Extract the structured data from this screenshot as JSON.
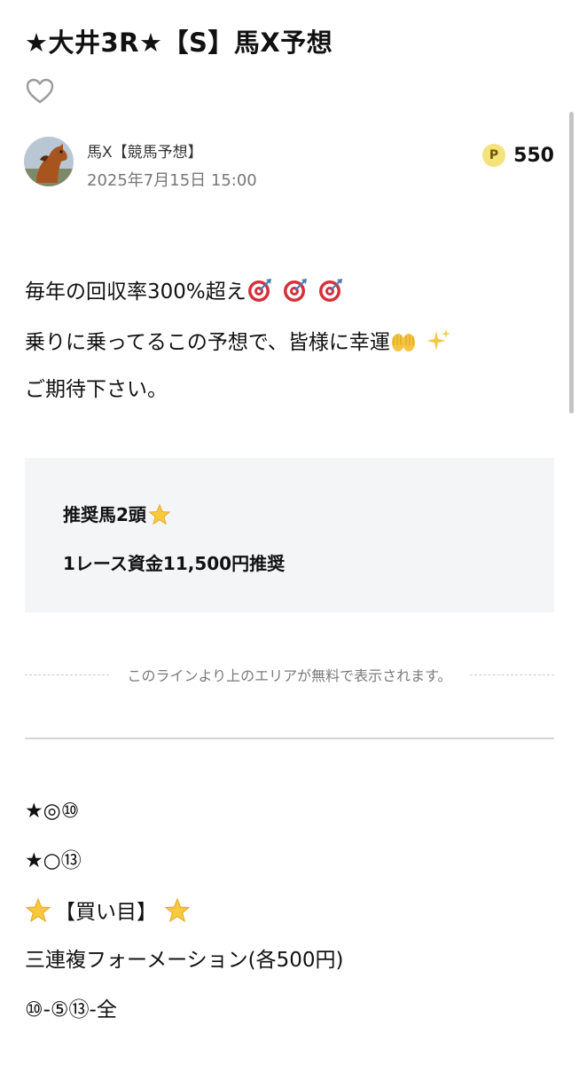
{
  "article": {
    "title": "★大井3R★【S】馬X予想",
    "like_icon": "heart-outline-icon"
  },
  "author": {
    "name": "馬X【競馬予想】",
    "date": "2025年7月15日 15:00",
    "avatar_icon": "horse-avatar"
  },
  "price": {
    "coin_label": "P",
    "value": "550",
    "coin_color": "#f6e27a"
  },
  "intro": {
    "line1": "毎年の回収率300%超え",
    "line2": "乗りに乗ってるこの予想で、皆様に幸運",
    "line3": "ご期待下さい。"
  },
  "highlight_box": {
    "line1": "推奨馬2頭",
    "line2": "1レース資金11,500円推奨"
  },
  "paywall": {
    "text": "このラインより上のエリアが無料で表示されます。"
  },
  "picks": {
    "line1": "★◎⑩",
    "line2": "★○⑬",
    "line3": "【買い目】",
    "line4": "三連複フォーメーション(各500円)",
    "line5": "⑩-⑤⑬-全"
  }
}
